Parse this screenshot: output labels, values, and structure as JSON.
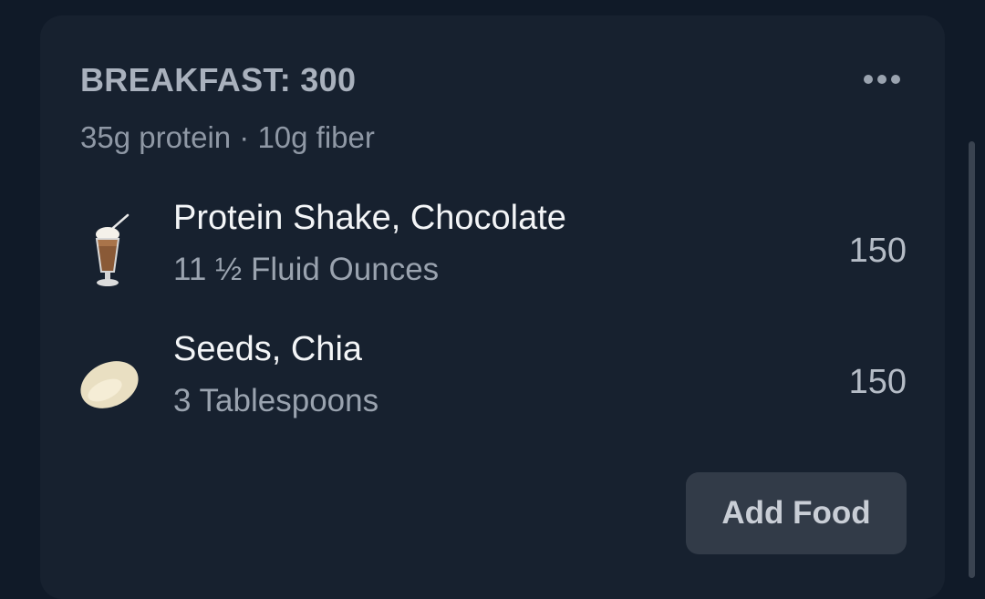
{
  "meal": {
    "title": "BREAKFAST: 300",
    "macros": "35g protein · 10g fiber",
    "more_icon": "more-horizontal-icon"
  },
  "foods": [
    {
      "name": "Protein Shake, Chocolate",
      "serving": "11 ½ Fluid Ounces",
      "calories": "150",
      "icon": "milkshake-icon"
    },
    {
      "name": "Seeds, Chia",
      "serving": "3 Tablespoons",
      "calories": "150",
      "icon": "seed-icon"
    }
  ],
  "actions": {
    "add_food_label": "Add Food"
  },
  "colors": {
    "background": "#101a28",
    "card": "#17212f",
    "button": "#323b48"
  }
}
